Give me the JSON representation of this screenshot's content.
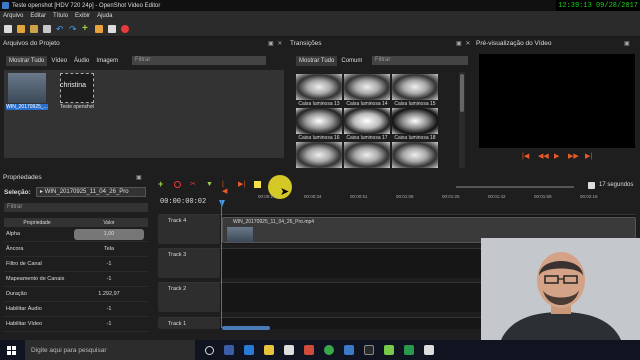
{
  "window": {
    "title": "Teste openshot [HDV 720 24p] - OpenShot Video Editor"
  },
  "clock": {
    "text": "12:39:13  09/28/2017"
  },
  "menu": [
    "Arquivo",
    "Editar",
    "Título",
    "Exibir",
    "Ajuda"
  ],
  "files_panel": {
    "title": "Arquivos do Projeto",
    "tabs": [
      "Mostrar Tudo",
      "Vídeo",
      "Áudio",
      "Imagem"
    ],
    "filter_placeholder": "Filtrar",
    "items": [
      {
        "name": "WIN_20170925_...",
        "selected": true
      },
      {
        "name": "Teste openshot",
        "selected": false
      }
    ],
    "overlay_label": "christina"
  },
  "transitions_panel": {
    "title": "Transições",
    "tabs": [
      "Mostrar Tudo",
      "Comum"
    ],
    "filter_placeholder": "Filtrar",
    "items": [
      "Caixa luminosa 13",
      "Caixa luminosa 14",
      "Caixa luminosa 15",
      "Caixa luminosa 16",
      "Caixa luminosa 17",
      "Caixa luminosa 18"
    ]
  },
  "preview_panel": {
    "title": "Pré-visualização do Vídeo"
  },
  "properties_panel": {
    "title": "Propriedades",
    "selection_label": "Seleção:",
    "selection_value": "WIN_20170925_11_04_26_Pro",
    "filter_placeholder": "Filtrar",
    "col_property": "Propriedade",
    "col_value": "Valor",
    "rows": [
      {
        "name": "Alpha",
        "value": "1,00",
        "hl": true
      },
      {
        "name": "Âncora",
        "value": "Tela",
        "hl": false
      },
      {
        "name": "Filtro de Canal",
        "value": "-1",
        "hl": false
      },
      {
        "name": "Mapeamento de Canais",
        "value": "-1",
        "hl": false
      },
      {
        "name": "Duração",
        "value": "1.292,97",
        "hl": false
      },
      {
        "name": "Habilitar Áudio",
        "value": "-1",
        "hl": false
      },
      {
        "name": "Habilitar Vídeo",
        "value": "-1",
        "hl": false
      }
    ]
  },
  "timeline": {
    "timecode": "00:00:00:02",
    "zoom_label": "17 segundos",
    "ruler": [
      "00:00:17",
      "00:00:34",
      "00:00:51",
      "00:01:08",
      "00:01:25",
      "00:01:42",
      "00:01:59",
      "00:02:16"
    ],
    "tracks": [
      "Track 4",
      "Track 3",
      "Track 2",
      "Track 1"
    ],
    "clip_title": "WIN_20170925_11_04_26_Pro.mp4"
  },
  "taskbar": {
    "search_placeholder": "Digite aqui para pesquisar"
  },
  "colors": {
    "accent": "#e85a2a",
    "selection": "#2a6fcb",
    "clock": "#19d419",
    "playhead": "#e83a3a"
  }
}
